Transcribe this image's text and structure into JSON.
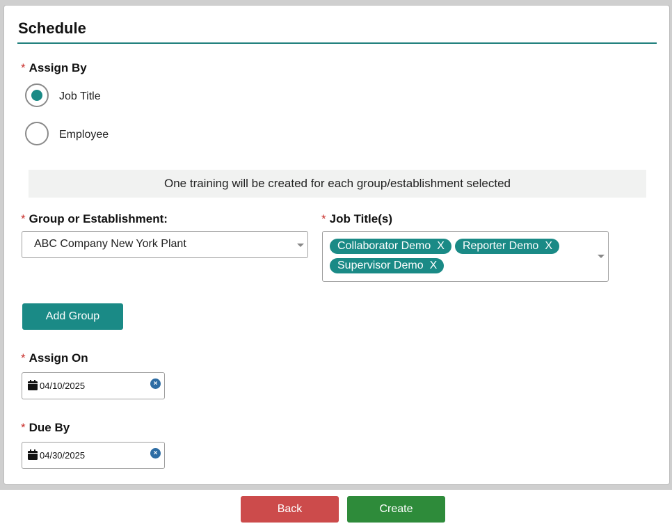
{
  "section": {
    "title": "Schedule"
  },
  "assign_by": {
    "label": "Assign By",
    "required_mark": "*",
    "options": [
      {
        "label": "Job Title",
        "selected": true
      },
      {
        "label": "Employee",
        "selected": false
      }
    ]
  },
  "banner": {
    "text": "One training will be created for each group/establishment selected"
  },
  "group": {
    "label": "Group or Establishment:",
    "required_mark": "*",
    "value": "ABC Company New York Plant"
  },
  "job_titles": {
    "label": "Job Title(s)",
    "required_mark": "*",
    "chips": [
      {
        "label": "Collaborator Demo",
        "remove": "X"
      },
      {
        "label": "Reporter Demo",
        "remove": "X"
      },
      {
        "label": "Supervisor Demo",
        "remove": "X"
      }
    ]
  },
  "add_group": {
    "label": "Add Group"
  },
  "assign_on": {
    "label": "Assign On",
    "required_mark": "*",
    "value": "04/10/2025",
    "clear": "×"
  },
  "due_by": {
    "label": "Due By",
    "required_mark": "*",
    "value": "04/30/2025",
    "clear": "×"
  },
  "footer": {
    "back_label": "Back",
    "create_label": "Create"
  },
  "colors": {
    "accent": "#1a8a86",
    "danger": "#cc4b4b",
    "success": "#2e8b3a",
    "required": "#c9302c"
  },
  "icons": {
    "calendar": "calendar-icon",
    "clear": "clear-circle-icon",
    "dropdown": "caret-down-icon"
  }
}
